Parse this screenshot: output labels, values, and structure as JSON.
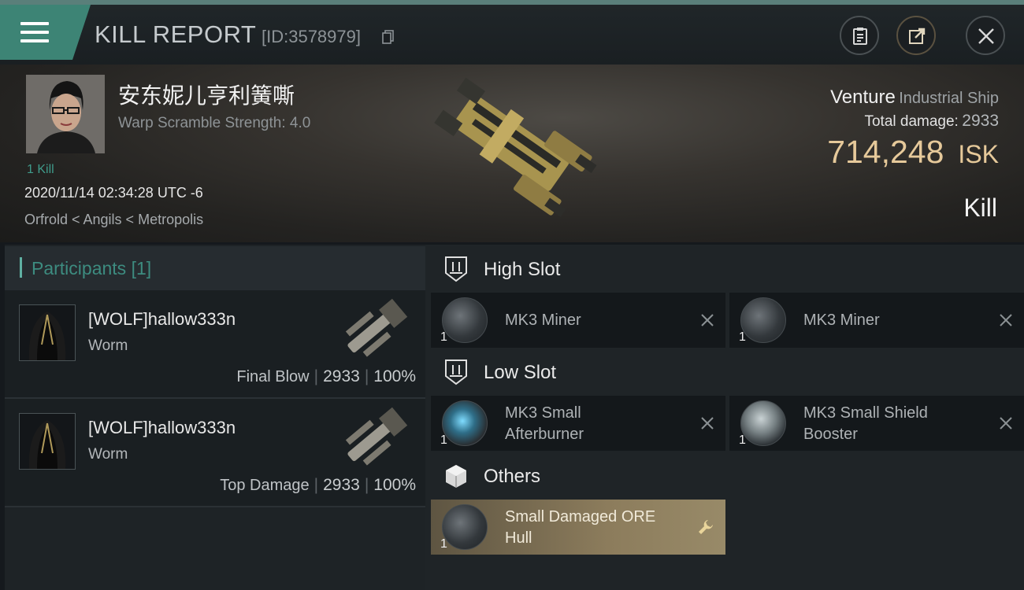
{
  "header": {
    "title": "KILL REPORT",
    "report_id": "[ID:3578979]"
  },
  "victim": {
    "name": "安东妮儿亨利簧嘶",
    "warp_scramble": "Warp Scramble Strength: 4.0",
    "kills": "1 Kill",
    "time": "2020/11/14 02:34:28 UTC -6",
    "location": "Orfrold < Angils < Metropolis"
  },
  "ship": {
    "name": "Venture",
    "class": "Industrial Ship",
    "total_damage_label": "Total damage:",
    "total_damage_value": "2933",
    "isk_value": "714,248",
    "isk_unit": "ISK",
    "result": "Kill"
  },
  "participants": {
    "title": "Participants",
    "count": "[1]",
    "items": [
      {
        "name": "[WOLF]hallow333n",
        "ship": "Worm",
        "label": "Final Blow",
        "damage": "2933",
        "percent": "100%"
      },
      {
        "name": "[WOLF]hallow333n",
        "ship": "Worm",
        "label": "Top Damage",
        "damage": "2933",
        "percent": "100%"
      }
    ]
  },
  "slots": {
    "high": {
      "title": "High Slot",
      "items": [
        {
          "name_line1": "MK3 Miner",
          "name_line2": "",
          "qty": "1"
        },
        {
          "name_line1": "MK3 Miner",
          "name_line2": "",
          "qty": "1"
        }
      ]
    },
    "low": {
      "title": "Low Slot",
      "items": [
        {
          "name_line1": "MK3 Small",
          "name_line2": "Afterburner",
          "qty": "1"
        },
        {
          "name_line1": "MK3 Small Shield",
          "name_line2": "Booster",
          "qty": "1"
        }
      ]
    },
    "others": {
      "title": "Others",
      "items": [
        {
          "name_line1": "Small Damaged ORE",
          "name_line2": "Hull",
          "qty": "1"
        }
      ]
    }
  },
  "colors": {
    "accent": "#3d8475",
    "isk": "#e6c99a",
    "dropped_item": "#8c7c5c"
  },
  "icons": {
    "menu": "hamburger-icon",
    "copy": "copy-icon",
    "clipboard": "clipboard-icon",
    "share": "share-icon",
    "close": "close-icon",
    "high_slot": "high-slot-icon",
    "low_slot": "low-slot-icon",
    "others": "cube-icon",
    "destroyed": "x-icon",
    "dropped": "wrench-icon"
  }
}
